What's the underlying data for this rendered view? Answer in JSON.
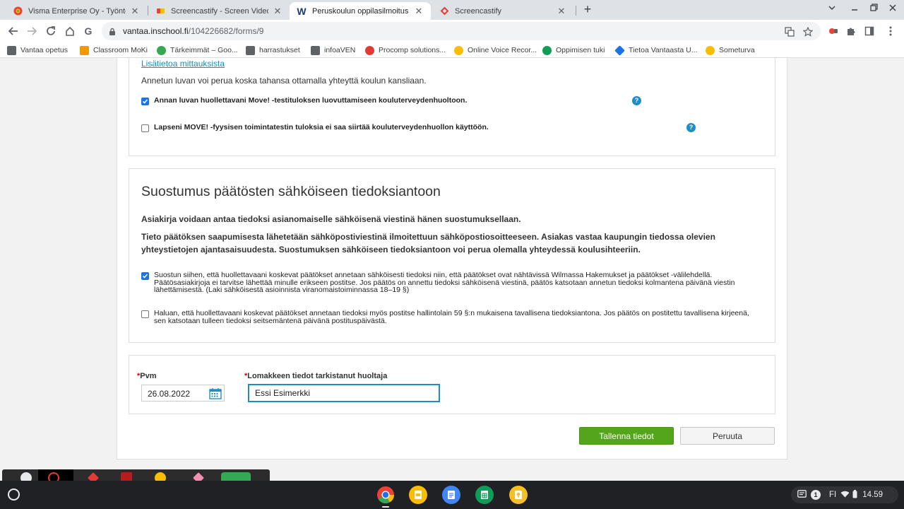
{
  "browser": {
    "tabs": [
      {
        "title": "Visma Enterprise Oy - Työntekijä",
        "close": "✕",
        "favicon_color": "#ea4335"
      },
      {
        "title": "Screencastify - Screen Video Rec",
        "close": "✕",
        "favicon_color": "#fbbc04"
      },
      {
        "title": "Peruskoulun oppilasilmoitus - W",
        "close": "✕",
        "favicon_letter": "W"
      },
      {
        "title": "Screencastify",
        "close": "✕",
        "favicon_color": "#e53935"
      }
    ],
    "url_host": "vantaa.inschool.fi",
    "url_path": "/104226682/forms/9",
    "bookmarks": [
      {
        "label": "Vantaa opetus",
        "color": "#5f6368"
      },
      {
        "label": "Classroom MoKi",
        "color": "#f29900"
      },
      {
        "label": "Tärkeimmät – Goo...",
        "color": "#34a853"
      },
      {
        "label": "harrastukset",
        "color": "#5f6368"
      },
      {
        "label": "infoaVEN",
        "color": "#5f6368"
      },
      {
        "label": "Procomp solutions...",
        "color": "#e53935"
      },
      {
        "label": "Online Voice Recor...",
        "color": "#fbbc04"
      },
      {
        "label": "Oppimisen tuki",
        "color": "#0f9d58"
      },
      {
        "label": "Tietoa Vantaasta U...",
        "color": "#1a73e8"
      },
      {
        "label": "Someturva",
        "color": "#fbbc04"
      }
    ]
  },
  "form": {
    "measure_link": "Lisätietoa mittauksista",
    "revoke_text": "Annetun luvan voi perua koska tahansa ottamalla yhteyttä koulun kansliaan.",
    "move_checkbox_1": "Annan luvan huollettavani Move! -testituloksen luovuttamiseen kouluterveydenhuoltoon.",
    "move_checkbox_2": "Lapseni MOVE! -fyysisen toimintatestin tuloksia ei saa siirtää kouluterveydenhuollon käyttöön.",
    "consent_title": "Suostumus päätösten sähköiseen tiedoksiantoon",
    "consent_p1": "Asiakirja voidaan antaa tiedoksi asianomaiselle sähköisenä viestinä hänen suostumuksellaan.",
    "consent_p2": "Tieto päätöksen saapumisesta lähetetään sähköpostiviestinä ilmoitettuun sähköpostiosoitteeseen. Asiakas vastaa kaupungin tiedossa olevien yhteystietojen ajantasaisuudesta. Suostumuksen sähköiseen tiedoksiantoon voi perua olemalla yhteydessä koulusihteeriin.",
    "consent_checkbox_1": "Suostun siihen, että huollettavaani koskevat päätökset annetaan sähköisesti tiedoksi niin, että päätökset ovat nähtävissä Wilmassa Hakemukset ja päätökset -välilehdellä. Päätösasiakirjoja ei tarvitse lähettää minulle erikseen postitse. Jos päätös on annettu tiedoksi sähköisenä viestinä, päätös katsotaan annetun tiedoksi kolmantena päivänä viestin lähettämisestä. (Laki sähköisestä asioinnista viranomaistoiminnassa 18–19 §)",
    "consent_checkbox_2": "Haluan, että huollettavaani koskevat päätökset annetaan tiedoksi myös postitse hallintolain 59 §:n mukaisena tavallisena tiedoksiantona. Jos päätös on postitettu tavallisena kirjeenä, sen katsotaan tulleen tiedoksi seitsemäntenä päivänä postituspäivästä.",
    "required_mark": "*",
    "date_label": "Pvm",
    "date_value": "26.08.2022",
    "checker_label": "Lomakkeen tiedot tarkistanut huoltaja",
    "checker_value": "Essi Esimerkki",
    "save_button": "Tallenna tiedot",
    "cancel_button": "Peruuta"
  },
  "shelf": {
    "locale": "FI",
    "notification_count": "1",
    "time": "14.59"
  },
  "colors": {
    "accent": "#1e8fc5",
    "save": "#54a51c",
    "link": "#1b8fb0"
  }
}
